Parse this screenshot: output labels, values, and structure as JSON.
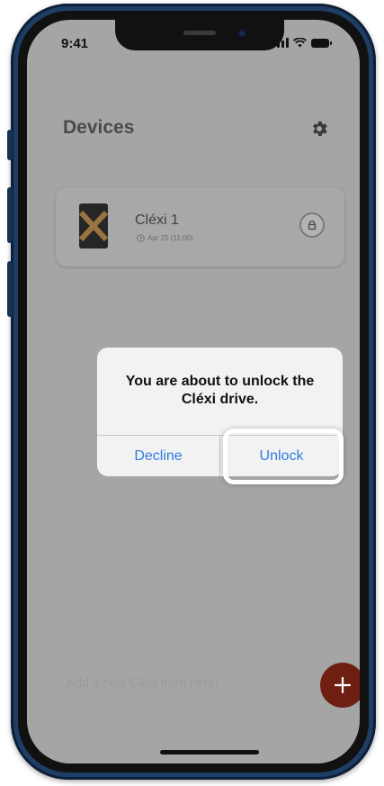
{
  "status_bar": {
    "time": "9:41"
  },
  "header": {
    "title": "Devices",
    "settings_icon": "gear-icon"
  },
  "devices": [
    {
      "name": "Cléxi 1",
      "last_seen": "Apr 25 (11:00)",
      "lock_icon": "lock-icon"
    }
  ],
  "alert": {
    "message": "You are about to unlock the Cléxi drive.",
    "decline_label": "Decline",
    "unlock_label": "Unlock"
  },
  "footer": {
    "hint": "Add a new Clexi from here!",
    "hint_arrow": "→",
    "add_icon": "plus-icon"
  },
  "colors": {
    "accent_link": "#2f7de1",
    "add_button": "#6f1e12",
    "overlay": "#a5a5a5"
  }
}
